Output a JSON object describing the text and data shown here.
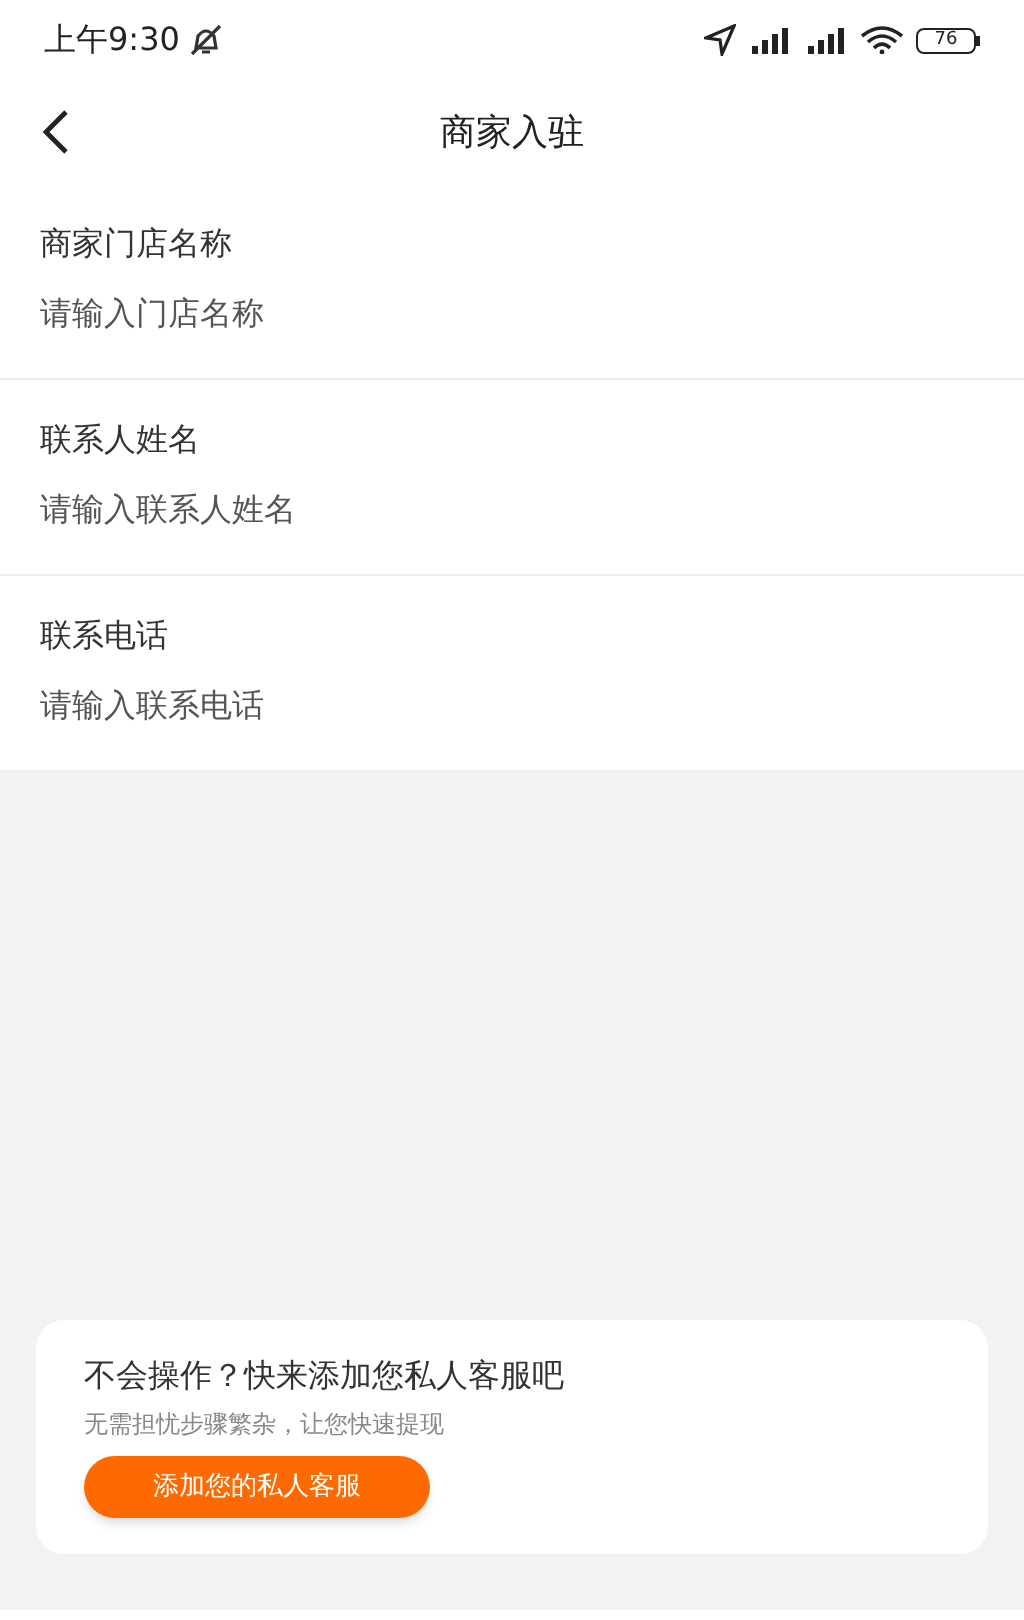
{
  "status_bar": {
    "time": "上午9:30",
    "battery": "76"
  },
  "header": {
    "title": "商家入驻"
  },
  "fields": [
    {
      "label": "商家门店名称",
      "placeholder": "请输入门店名称"
    },
    {
      "label": "联系人姓名",
      "placeholder": "请输入联系人姓名"
    },
    {
      "label": "联系电话",
      "placeholder": "请输入联系电话"
    }
  ],
  "help_card": {
    "title": "不会操作？快来添加您私人客服吧",
    "subtitle": "无需担忧步骤繁杂，让您快速提现",
    "button": "添加您的私人客服"
  }
}
